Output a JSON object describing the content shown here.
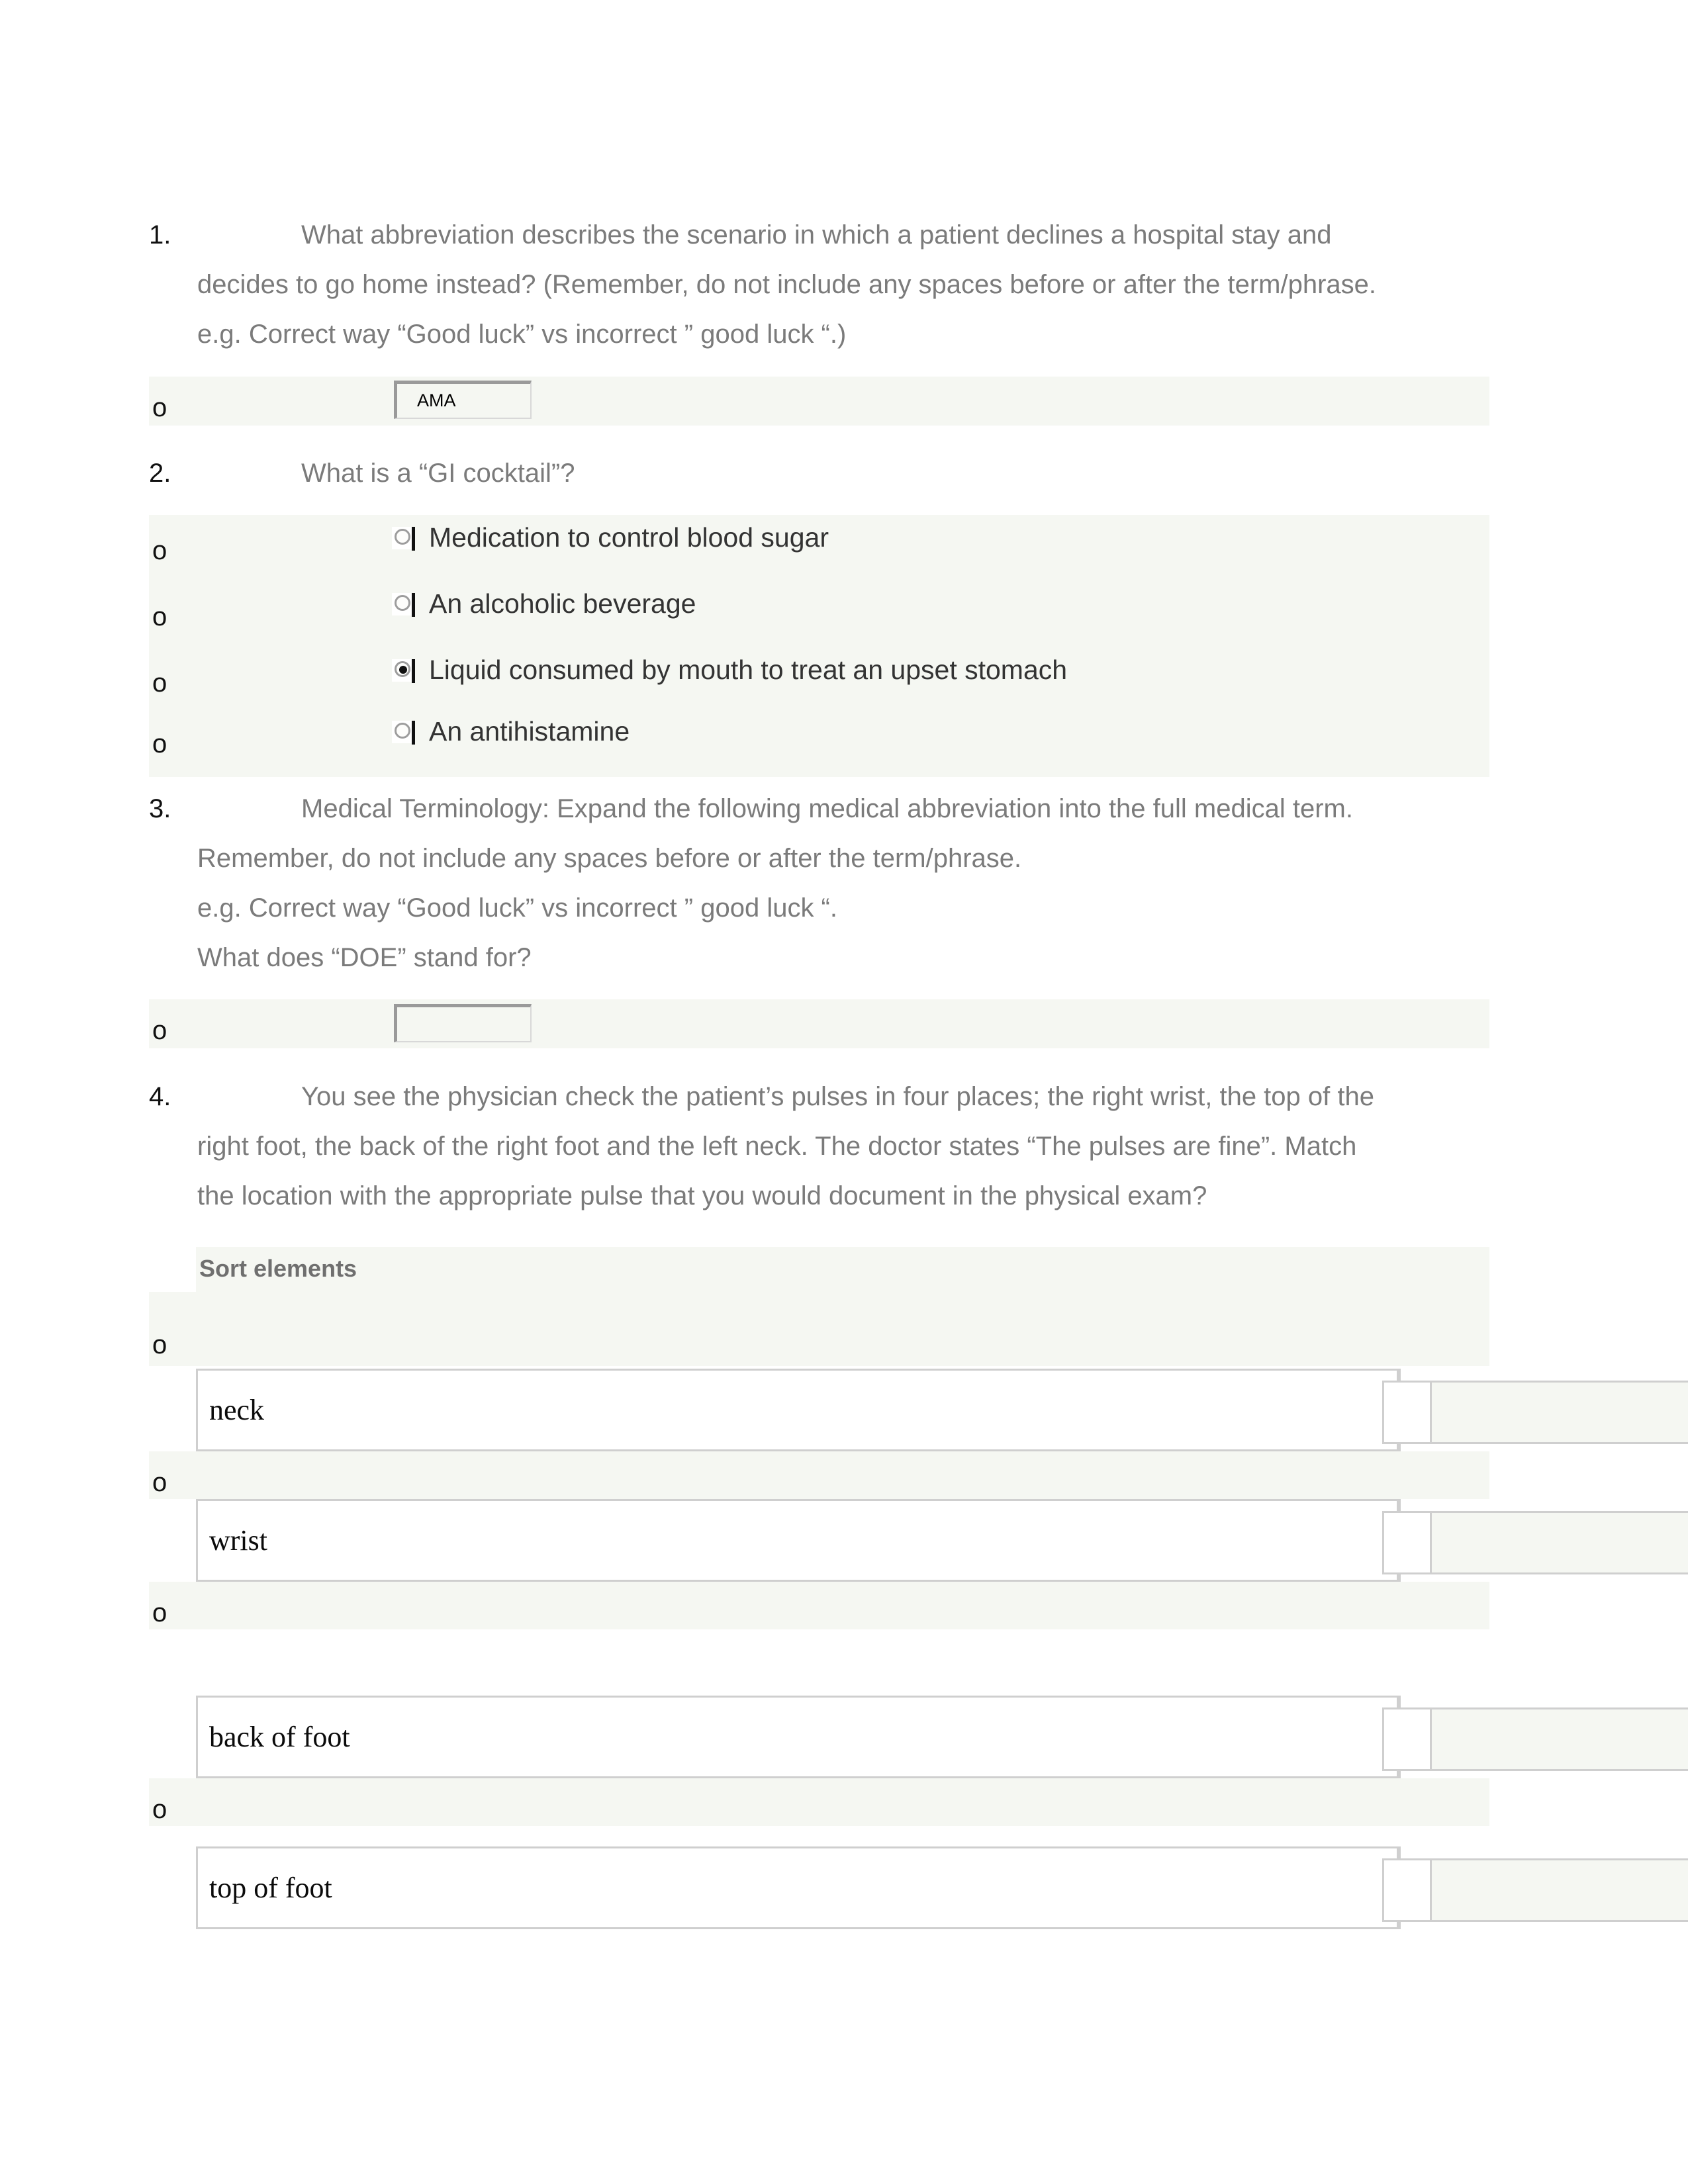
{
  "document": {
    "type": "quiz-worksheet",
    "background_color": "#ffffff",
    "band_color": "#f5f7f2",
    "question_text_color": "#7b7b7b",
    "answer_text_color": "#333333"
  },
  "questions": [
    {
      "number": "1.",
      "lines": [
        "What abbreviation describes the scenario in which a patient declines a hospital stay and",
        "decides to go home instead? (Remember, do not include any spaces before or after the term/phrase.",
        "e.g. Correct way “Good luck” vs incorrect ” good luck “.)"
      ],
      "answer_type": "text-input",
      "bullet": "o",
      "input_value": "AMA"
    },
    {
      "number": "2.",
      "lines": [
        "What is a “GI cocktail”?"
      ],
      "answer_type": "multiple-choice",
      "options": [
        {
          "bullet": "o",
          "label": "Medication to control blood sugar",
          "selected": false
        },
        {
          "bullet": "o",
          "label": "An alcoholic beverage",
          "selected": false
        },
        {
          "bullet": "o",
          "label": "Liquid consumed by mouth to treat an upset stomach",
          "selected": true
        },
        {
          "bullet": "o",
          "label": "An antihistamine",
          "selected": false
        }
      ]
    },
    {
      "number": "3.",
      "lines": [
        "Medical Terminology: Expand the following medical abbreviation into the full medical term.",
        "Remember, do not include any spaces before or after the term/phrase.",
        "e.g. Correct way “Good luck” vs incorrect ” good luck “.",
        "What does “DOE” stand for?"
      ],
      "answer_type": "text-input",
      "bullet": "o",
      "input_value": ""
    },
    {
      "number": "4.",
      "lines": [
        "You see the physician check the patient’s pulses in four places; the right wrist, the top of the",
        "right foot, the back of the right foot and the left neck. The doctor states “The pulses are fine”. Match",
        "the location with the appropriate pulse that you would document in the physical exam?"
      ],
      "answer_type": "sort-match",
      "sort_heading": "Sort elements",
      "sort_items": [
        {
          "bullet": "o",
          "label": "neck",
          "slot_value": ""
        },
        {
          "bullet": "o",
          "label": "wrist",
          "slot_value": ""
        },
        {
          "bullet": "o",
          "label": "back of foot",
          "slot_value": ""
        },
        {
          "bullet": "o",
          "label": "top of foot",
          "slot_value": ""
        }
      ]
    }
  ]
}
